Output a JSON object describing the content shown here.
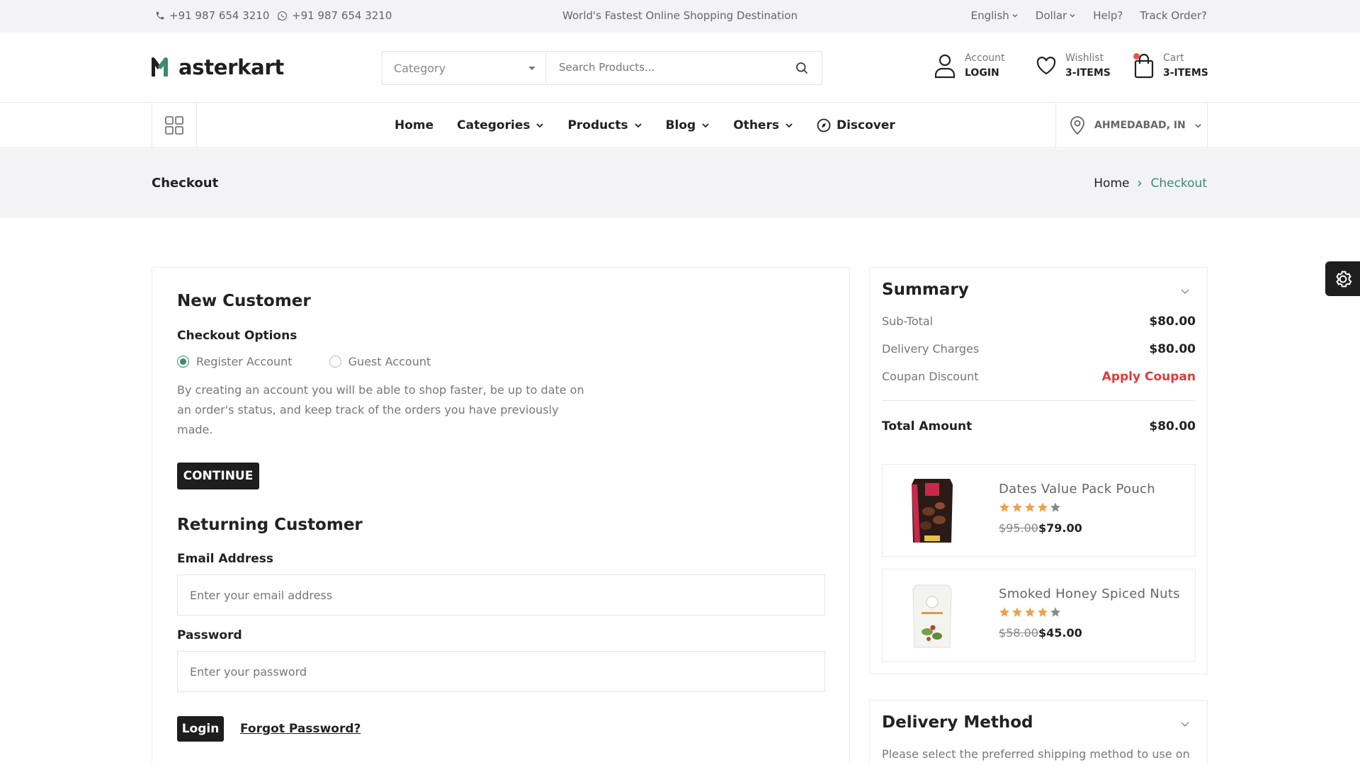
{
  "topbar": {
    "phone1": "+91 987 654 3210",
    "phone2": "+91 987 654 3210",
    "tagline": "World's Fastest Online Shopping Destination",
    "language": "English",
    "currency": "Dollar",
    "help": "Help?",
    "track": "Track Order?"
  },
  "header": {
    "logo_rest": "asterkart",
    "category_placeholder": "Category",
    "search_placeholder": "Search Products...",
    "account_label": "Account",
    "account_value": "LOGIN",
    "wishlist_label": "Wishlist",
    "wishlist_value": "3-ITEMS",
    "cart_label": "Cart",
    "cart_value": "3-ITEMS"
  },
  "nav": {
    "items": [
      "Home",
      "Categories",
      "Products",
      "Blog",
      "Others",
      "Discover"
    ],
    "location": "AHMEDABAD, IN"
  },
  "breadcrumb": {
    "page_title": "Checkout",
    "home": "Home",
    "current": "Checkout"
  },
  "new_customer": {
    "title": "New Customer",
    "options_label": "Checkout Options",
    "option_register": "Register Account",
    "option_guest": "Guest Account",
    "selected": "Register Account",
    "description": "By creating an account you will be able to shop faster, be up to date on an order's status, and keep track of the orders you have previously made.",
    "continue_label": "CONTINUE"
  },
  "returning_customer": {
    "title": "Returning Customer",
    "email_label": "Email Address",
    "email_placeholder": "Enter your email address",
    "password_label": "Password",
    "password_placeholder": "Enter your password",
    "login_label": "Login",
    "forgot_label": "Forgot Password?"
  },
  "summary": {
    "title": "Summary",
    "subtotal_label": "Sub-Total",
    "subtotal_value": "$80.00",
    "delivery_label": "Delivery Charges",
    "delivery_value": "$80.00",
    "coupon_label": "Coupan Discount",
    "coupon_action": "Apply Coupan",
    "total_label": "Total Amount",
    "total_value": "$80.00",
    "products": [
      {
        "name": "Dates Value Pack Pouch",
        "rating": 4,
        "old_price": "$95.00",
        "new_price": "$79.00"
      },
      {
        "name": "Smoked Honey Spiced Nuts",
        "rating": 4,
        "old_price": "$58.00",
        "new_price": "$45.00"
      }
    ]
  },
  "delivery": {
    "title": "Delivery Method",
    "text": "Please select the preferred shipping method to use on"
  },
  "colors": {
    "accent_green": "#3d8a6f",
    "dark": "#1e1e1e",
    "coupon_red": "#e03a3a",
    "star_orange": "#f0a04b"
  }
}
